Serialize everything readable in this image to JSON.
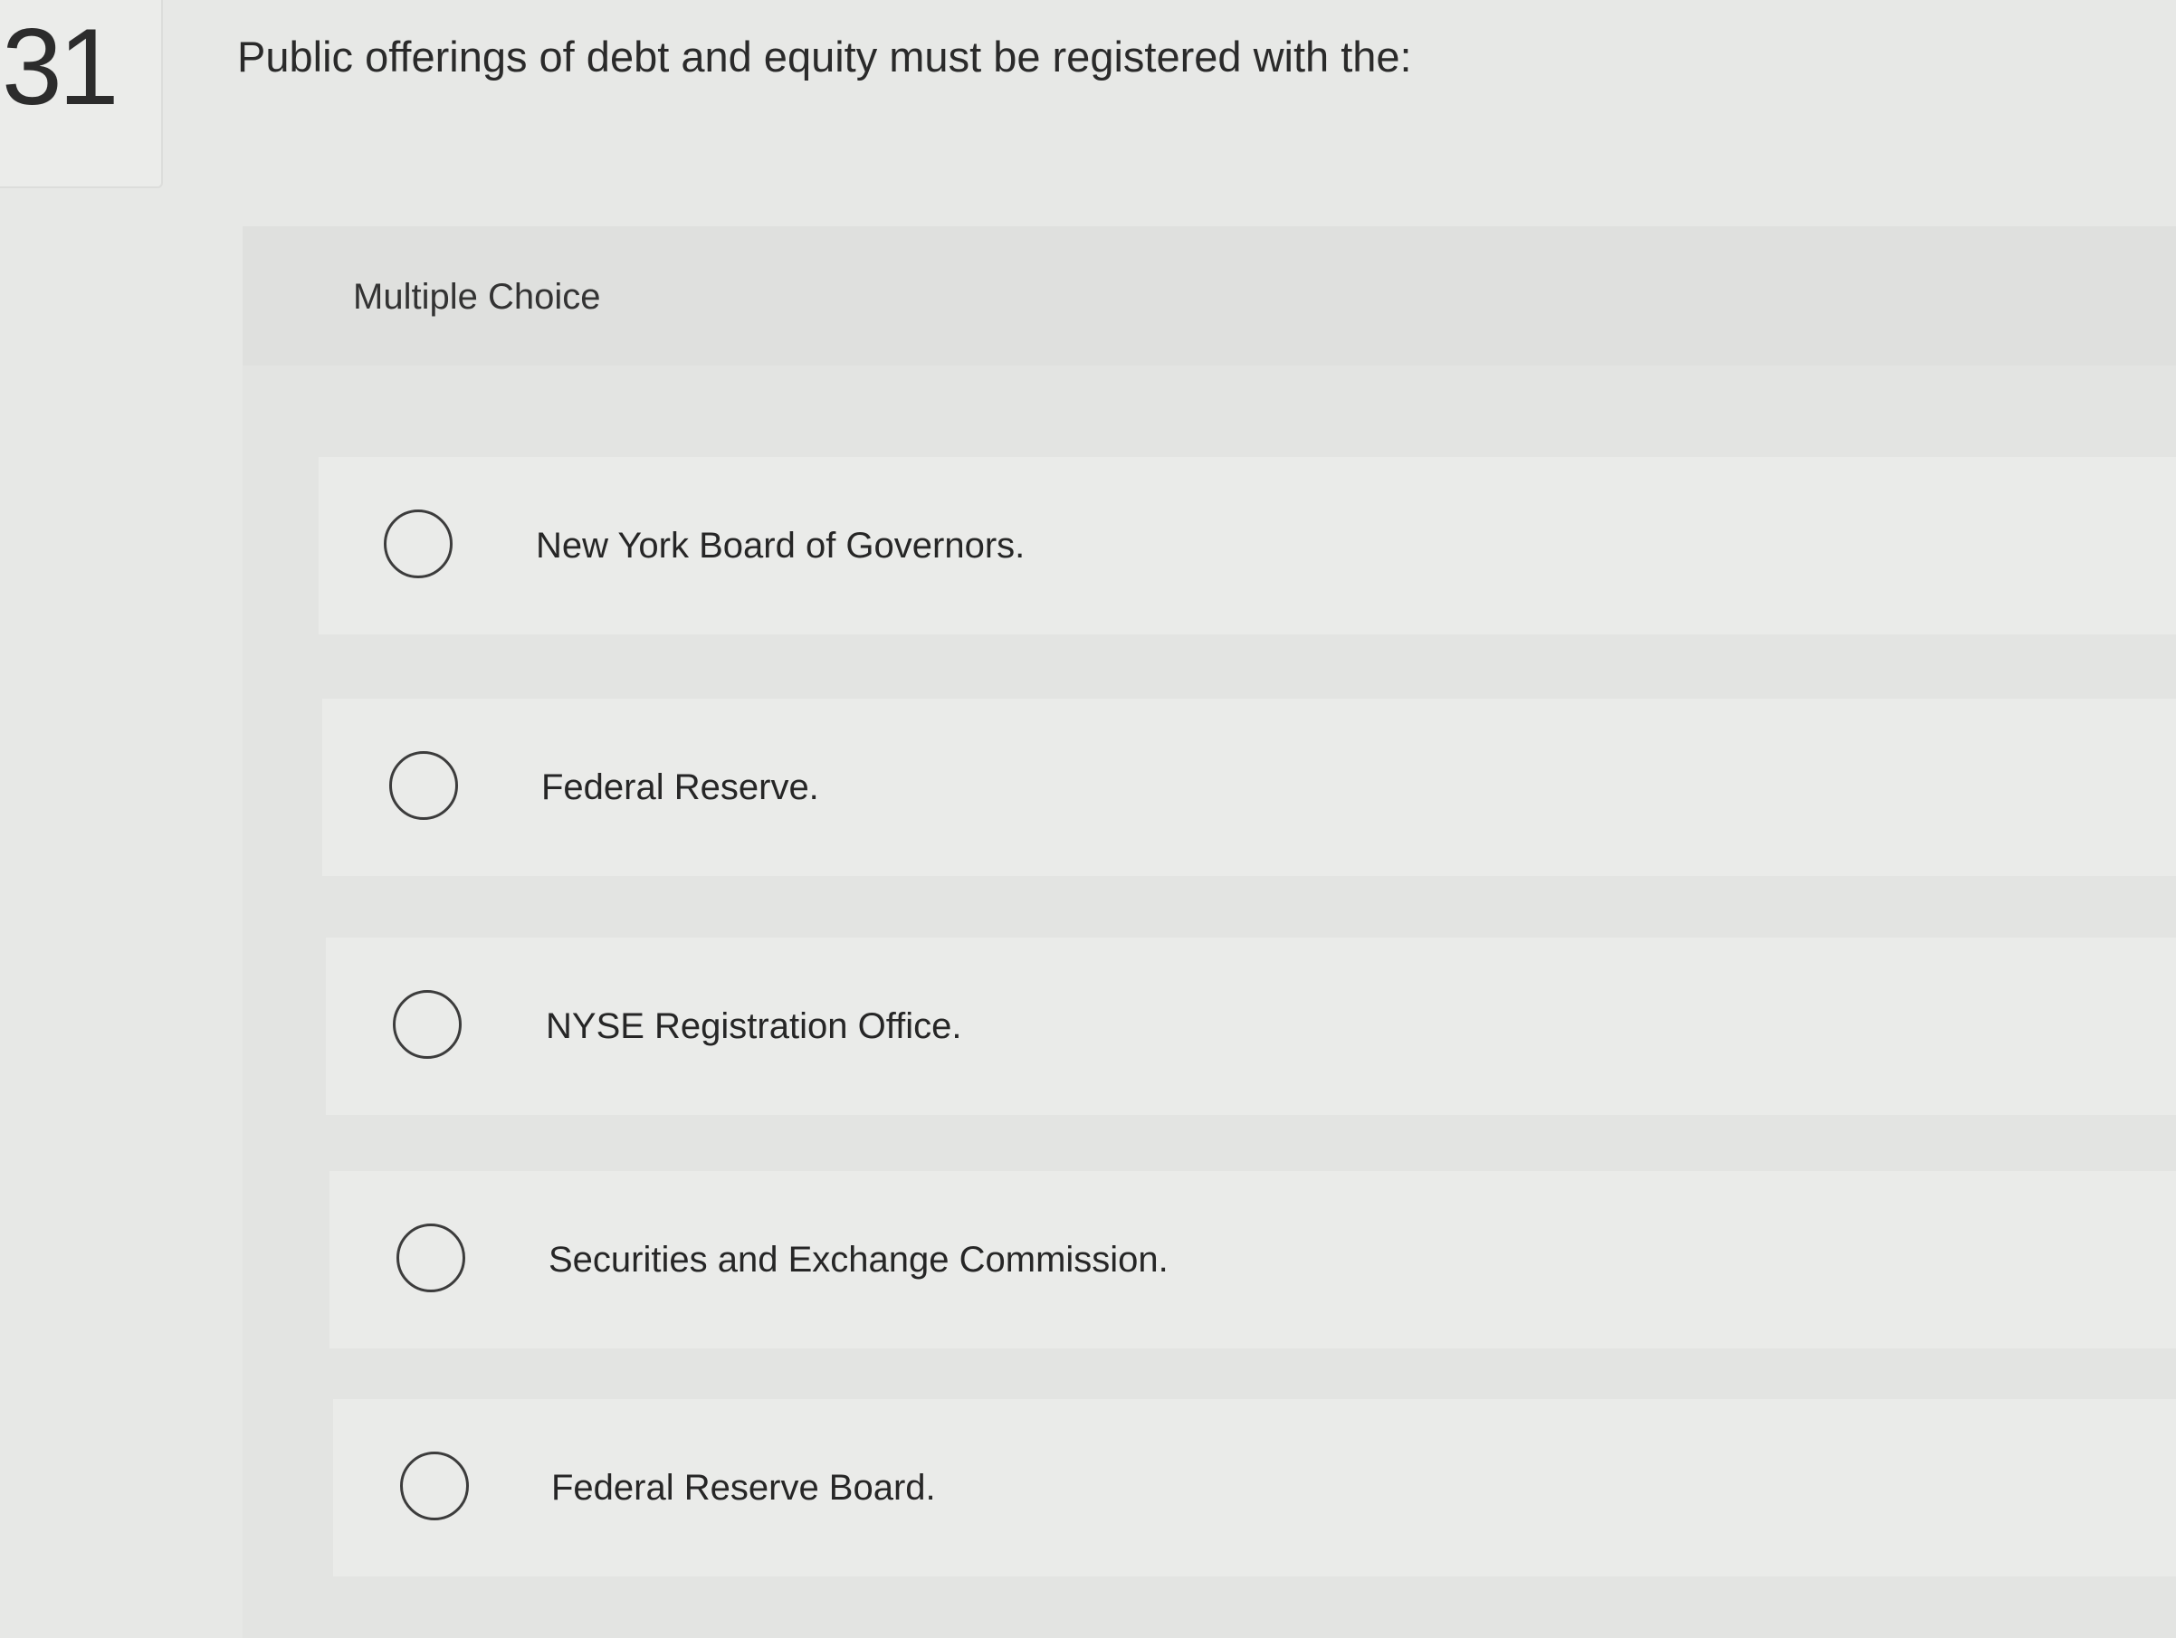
{
  "question": {
    "number": "31",
    "text": "Public offerings of debt and equity must be registered with the:"
  },
  "panel": {
    "title": "Multiple Choice"
  },
  "options": [
    {
      "label": "New York Board of Governors."
    },
    {
      "label": "Federal Reserve."
    },
    {
      "label": "NYSE Registration Office."
    },
    {
      "label": "Securities and Exchange Commission."
    },
    {
      "label": "Federal Reserve Board."
    }
  ]
}
